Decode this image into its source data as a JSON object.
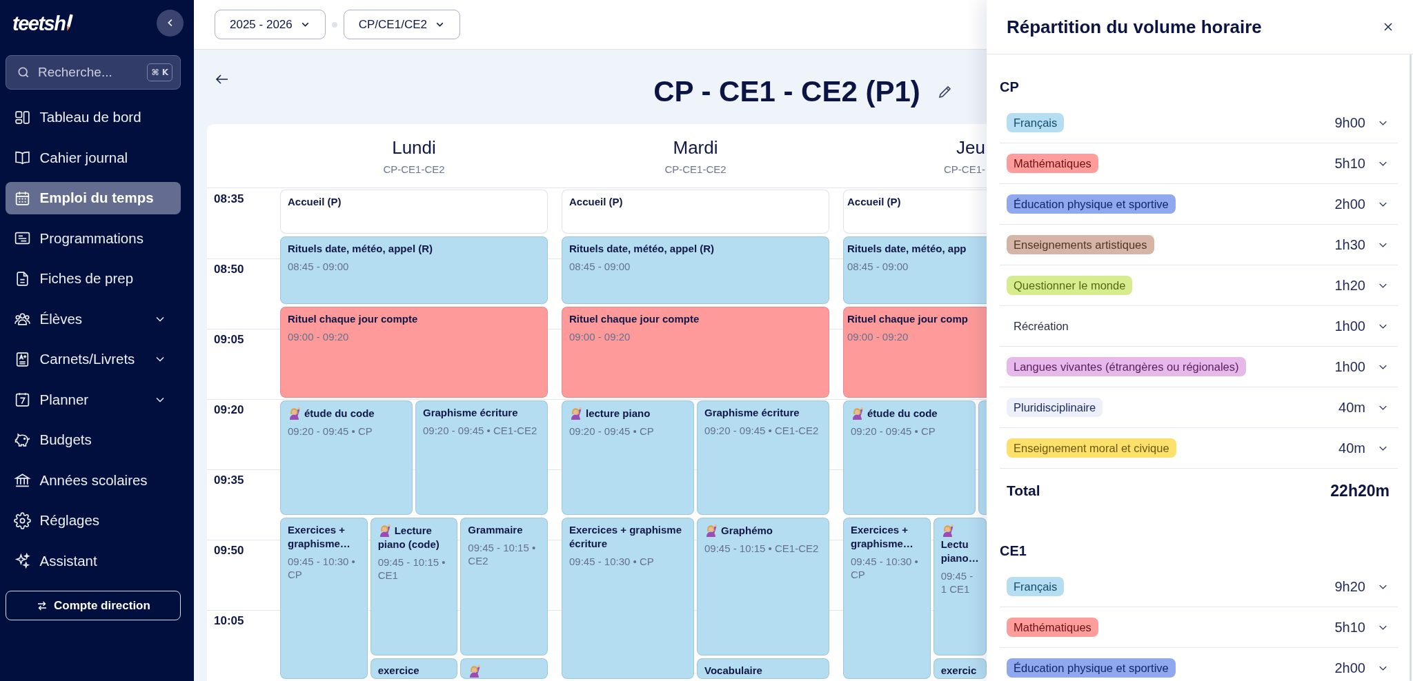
{
  "sidebar": {
    "logo": "teetsh",
    "search": {
      "placeholder": "Recherche...",
      "shortcut": "⌘ K"
    },
    "items": [
      {
        "label": "Tableau de bord",
        "selected": false
      },
      {
        "label": "Cahier journal",
        "selected": false
      },
      {
        "label": "Emploi du temps",
        "selected": true
      },
      {
        "label": "Programmations",
        "selected": false
      },
      {
        "label": "Fiches de prep",
        "selected": false
      },
      {
        "label": "Élèves",
        "selected": false,
        "expanded": false
      },
      {
        "label": "Carnets/Livrets",
        "selected": false,
        "expanded": false
      },
      {
        "label": "Planner",
        "selected": false,
        "expanded": false
      },
      {
        "label": "Budgets",
        "selected": false
      },
      {
        "label": "Années scolaires",
        "selected": false
      },
      {
        "label": "Réglages",
        "selected": false
      },
      {
        "label": "Assistant",
        "selected": false
      }
    ],
    "account_button": "Compte direction"
  },
  "toolbar": {
    "selectors": [
      {
        "label": "2025 - 2026"
      },
      {
        "label": "CP/CE1/CE2"
      }
    ]
  },
  "page": {
    "title": "CP - CE1 - CE2 (P1)"
  },
  "timetable": {
    "times": [
      "08:35",
      "08:50",
      "09:05",
      "09:20",
      "09:35",
      "09:50",
      "10:05"
    ],
    "days": [
      {
        "name": "Lundi",
        "classes": "CP-CE1-CE2",
        "events": [
          {
            "title": "Accueil (P)",
            "color": "#ffffff",
            "emoji": false
          },
          {
            "title": "Rituels date, météo, appel (R)",
            "time": "08:45 - 09:00",
            "color": "#b5ddf2",
            "emoji": false
          },
          {
            "title": "Rituel chaque jour compte",
            "time": "09:00 - 09:20",
            "color": "#fe9b9a",
            "emoji": false
          },
          {
            "title": "étude du code",
            "time": "09:20 - 09:45 • CP",
            "color": "#b5ddf2",
            "emoji": true
          },
          {
            "title": "Graphisme écriture",
            "time": "09:20 - 09:45 • CE1-CE2",
            "color": "#b5ddf2",
            "emoji": false
          },
          {
            "title": "Exercices + graphisme…",
            "time": "09:45 - 10:30 • CP",
            "color": "#b5ddf2",
            "emoji": false
          },
          {
            "title": "Lecture piano (code)",
            "time": "09:45 - 10:15 • CE1",
            "color": "#b5ddf2",
            "emoji": true
          },
          {
            "title": "Grammaire",
            "time": "09:45 - 10:15 • CE2",
            "color": "#b5ddf2",
            "emoji": false
          },
          {
            "title": "exercice",
            "color": "#b5ddf2",
            "emoji": false
          },
          {
            "color": "#b5ddf2",
            "emoji": true
          }
        ]
      },
      {
        "name": "Mardi",
        "classes": "CP-CE1-CE2",
        "events": [
          {
            "title": "Accueil (P)",
            "color": "#ffffff",
            "emoji": false
          },
          {
            "title": "Rituels date, météo, appel (R)",
            "time": "08:45 - 09:00",
            "color": "#b5ddf2",
            "emoji": false
          },
          {
            "title": "Rituel chaque jour compte",
            "time": "09:00 - 09:20",
            "color": "#fe9b9a",
            "emoji": false
          },
          {
            "title": "lecture piano",
            "time": "09:20 - 09:45 • CP",
            "color": "#b5ddf2",
            "emoji": true
          },
          {
            "title": "Graphisme écriture",
            "time": "09:20 - 09:45 • CE1-CE2",
            "color": "#b5ddf2",
            "emoji": false
          },
          {
            "title": "Exercices + graphisme écriture",
            "time": "09:45 - 10:30 • CP",
            "color": "#b5ddf2",
            "emoji": false
          },
          {
            "title": "Graphémo",
            "time": "09:45 - 10:15 • CE1-CE2",
            "color": "#b5ddf2",
            "emoji": true
          },
          {
            "title": "Vocabulaire",
            "color": "#b5ddf2",
            "emoji": false
          }
        ]
      },
      {
        "name": "Jeu",
        "classes": "CP-CE1-",
        "events": [
          {
            "title": "Accueil (P)",
            "color": "#ffffff",
            "emoji": false
          },
          {
            "title": "Rituels date, météo, app",
            "time": "08:45 - 09:00",
            "color": "#b5ddf2",
            "emoji": false
          },
          {
            "title": "Rituel chaque jour comp",
            "time": "09:00 - 09:20",
            "color": "#fe9b9a",
            "emoji": false
          },
          {
            "title": "étude du code",
            "time": "09:20 - 09:45 • CP",
            "color": "#b5ddf2",
            "emoji": true
          },
          {
            "color": "#b5ddf2"
          },
          {
            "title": "Exercices + graphisme…",
            "time": "09:45 - 10:30 • CP",
            "color": "#b5ddf2",
            "emoji": false
          },
          {
            "title": "Lectu piano…",
            "time": "09:45 - 1 CE1",
            "color": "#b5ddf2",
            "emoji": true
          },
          {
            "title": "exercic",
            "color": "#b5ddf2",
            "emoji": false
          }
        ]
      }
    ]
  },
  "panel": {
    "title": "Répartition du volume horaire",
    "sections": [
      {
        "heading": "CP",
        "rows": [
          {
            "subject": "Français",
            "color": "#b6def2",
            "duration": "9h00",
            "expanded": false
          },
          {
            "subject": "Mathématiques",
            "color": "#fe9d9c",
            "duration": "5h10",
            "expanded": false
          },
          {
            "subject": "Éducation physique et sportive",
            "color": "#8fa8ee",
            "duration": "2h00",
            "expanded": false
          },
          {
            "subject": "Enseignements artistiques",
            "color": "#d5b5a6",
            "duration": "1h30",
            "expanded": false
          },
          {
            "subject": "Questionner le monde",
            "color": "#d7ec8f",
            "duration": "1h20",
            "expanded": false
          },
          {
            "subject": "Récréation",
            "duration": "1h00",
            "expanded": false
          },
          {
            "subject": "Langues vivantes (étrangères ou régionales)",
            "color": "#e7b9ea",
            "duration": "1h00",
            "expanded": false
          },
          {
            "subject": "Pluridisciplinaire",
            "color": "#edf0fa",
            "duration": "40m",
            "expanded": false
          },
          {
            "subject": "Enseignement moral et civique",
            "color": "#fde16b",
            "duration": "40m",
            "expanded": false
          }
        ],
        "total": {
          "label": "Total",
          "value": "22h20m"
        }
      },
      {
        "heading": "CE1",
        "rows": [
          {
            "subject": "Français",
            "color": "#b6def2",
            "duration": "9h20",
            "expanded": false
          },
          {
            "subject": "Mathématiques",
            "color": "#fe9d9c",
            "duration": "5h10",
            "expanded": false
          },
          {
            "subject": "Éducation physique et sportive",
            "color": "#8fa8ee",
            "duration": "2h00",
            "expanded": false
          }
        ]
      }
    ]
  }
}
